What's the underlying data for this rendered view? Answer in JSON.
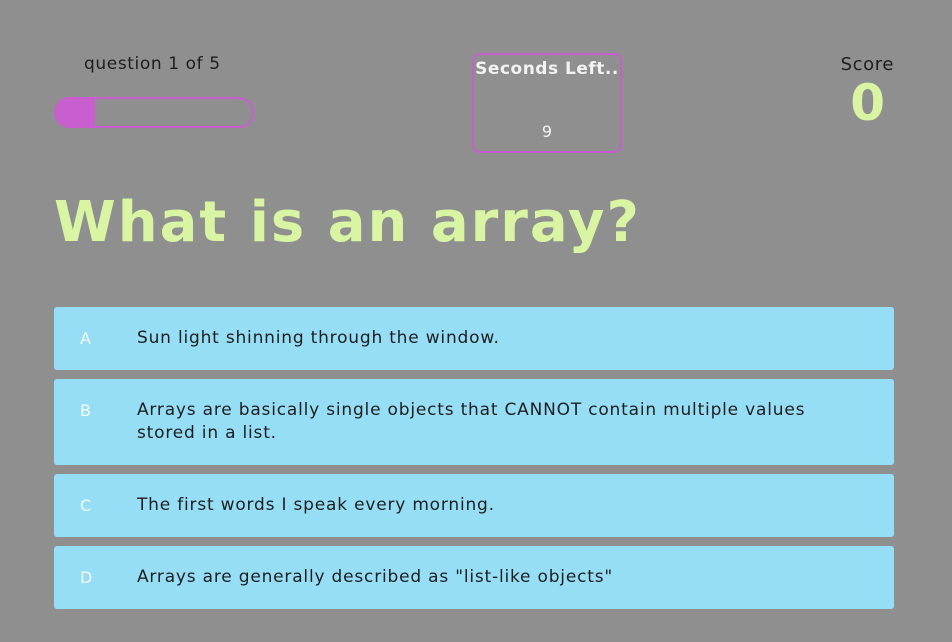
{
  "hud": {
    "question_counter": "question 1 of 5",
    "progress": 0.2,
    "timer_label": "Seconds Left..",
    "timer_value": "9",
    "score_label": "Score",
    "score_value": "0"
  },
  "question": {
    "text": "What is an array?"
  },
  "answers": [
    {
      "letter": "A",
      "text": "Sun light shinning through the window."
    },
    {
      "letter": "B",
      "text": "Arrays are basically single objects that CANNOT contain multiple values stored in a list."
    },
    {
      "letter": "C",
      "text": "The first words I speak every morning."
    },
    {
      "letter": "D",
      "text": "Arrays are generally described as \"list-like objects\""
    }
  ],
  "colors": {
    "background": "#8f8f8f",
    "accent": "#c95fcf",
    "highlight": "#d9f5a3",
    "answer_bg": "#96def6"
  }
}
